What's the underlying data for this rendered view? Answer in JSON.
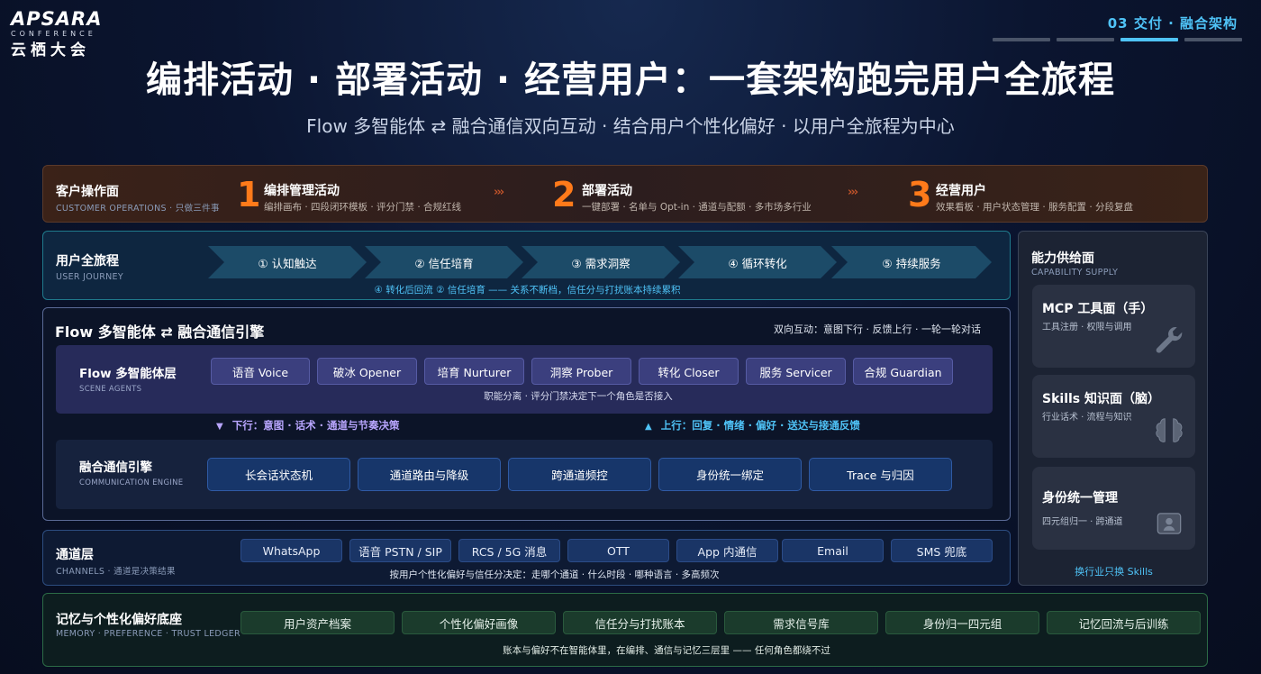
{
  "logo": {
    "main": "APSARA",
    "sub": "CONFERENCE",
    "cn": "云栖大会"
  },
  "header": {
    "section": "03 交付 · 融合架构",
    "title": "编排活动 · 部署活动 · 经营用户：一套架构跑完用户全旅程",
    "subtitle": "Flow 多智能体 ⇄ 融合通信双向互动 · 结合用户个性化偏好 · 以用户全旅程为中心"
  },
  "customer_ops": {
    "label": "客户操作面",
    "label_en": "CUSTOMER OPERATIONS · 只做三件事",
    "steps": [
      {
        "num": "1",
        "title": "编排管理活动",
        "desc": "编排画布 · 四段闭环模板 · 评分门禁 · 合规红线"
      },
      {
        "num": "2",
        "title": "部署活动",
        "desc": "一键部署 · 名单与 Opt-in · 通道与配额 · 多市场多行业"
      },
      {
        "num": "3",
        "title": "经营用户",
        "desc": "效果看板 · 用户状态管理 · 服务配置 · 分段复盘"
      }
    ],
    "chevron": "›››"
  },
  "journey": {
    "label": "用户全旅程",
    "label_en": "USER JOURNEY",
    "steps": [
      "① 认知触达",
      "② 信任培育",
      "③ 需求洞察",
      "④ 循环转化",
      "⑤ 持续服务"
    ],
    "note": "④ 转化后回流 ② 信任培育 —— 关系不断档，信任分与打扰账本持续累积"
  },
  "capability": {
    "label": "能力供给面",
    "label_en": "CAPABILITY SUPPLY",
    "cards": [
      {
        "title": "MCP 工具面（手）",
        "desc": "工具注册 · 权限与调用",
        "icon": "wrench-icon"
      },
      {
        "title": "Skills 知识面（脑）",
        "desc": "行业话术 · 流程与知识",
        "icon": "brain-icon"
      },
      {
        "title": "身份统一管理",
        "desc": "四元组归一 · 跨通道",
        "icon": "id-card-icon"
      }
    ],
    "link": "换行业只换 Skills"
  },
  "flow": {
    "title": "Flow 多智能体 ⇄ 融合通信引擎",
    "right_note": "双向互动：意图下行 · 反馈上行 · 一轮一轮对话",
    "agents_label": "Flow 多智能体层",
    "agents_label_en": "SCENE AGENTS",
    "agents": [
      "语音 Voice",
      "破冰 Opener",
      "培育 Nurturer",
      "洞察 Prober",
      "转化 Closer",
      "服务 Servicer",
      "合规 Guardian"
    ],
    "agents_note": "职能分离 · 评分门禁决定下一个角色是否接入",
    "down": "下行：意图 · 话术 · 通道与节奏决策",
    "up": "上行：回复 · 情绪 · 偏好 · 送达与接通反馈",
    "engine_label": "融合通信引擎",
    "engine_label_en": "COMMUNICATION ENGINE",
    "engine": [
      "长会话状态机",
      "通道路由与降级",
      "跨通道频控",
      "身份统一绑定",
      "Trace 与归因"
    ]
  },
  "channel": {
    "label": "通道层",
    "label_en": "CHANNELS · 通道是决策结果",
    "items": [
      "WhatsApp",
      "语音 PSTN / SIP",
      "RCS / 5G 消息",
      "OTT",
      "App 内通信",
      "Email",
      "SMS 兜底"
    ],
    "note": "按用户个性化偏好与信任分决定：走哪个通道 · 什么时段 · 哪种语言 · 多高频次"
  },
  "memory": {
    "label": "记忆与个性化偏好底座",
    "label_en": "MEMORY · PREFERENCE · TRUST LEDGER",
    "items": [
      "用户资产档案",
      "个性化偏好画像",
      "信任分与打扰账本",
      "需求信号库",
      "身份归一四元组",
      "记忆回流与后训练"
    ],
    "note": "账本与偏好不在智能体里，在编排、通信与记忆三层里 —— 任何角色都绕不过"
  },
  "colors": {
    "accent_orange": "#ff7a1a",
    "accent_cyan": "#4fc3f7",
    "accent_violet": "#b9a6ff"
  }
}
